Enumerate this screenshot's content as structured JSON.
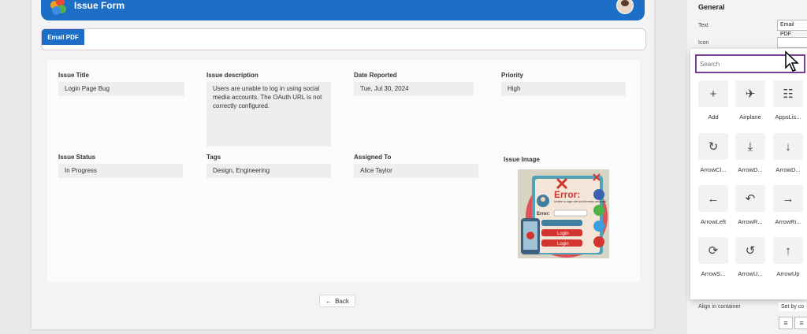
{
  "header": {
    "title": "Issue Form"
  },
  "toolbar": {
    "email_label": "Email PDF"
  },
  "form": {
    "issue_title": {
      "label": "Issue Title",
      "value": "Login Page Bug"
    },
    "issue_description": {
      "label": "Issue description",
      "value": "Users are unable to log in using social media accounts. The OAuth URL is not correctly configured."
    },
    "date_reported": {
      "label": "Date Reported",
      "value": "Tue, Jul 30, 2024"
    },
    "priority": {
      "label": "Priority",
      "value": "High"
    },
    "issue_status": {
      "label": "Issue Status",
      "value": "In Progress"
    },
    "tags": {
      "label": "Tags",
      "value": "Design, Engineering"
    },
    "assigned_to": {
      "label": "Assigned To",
      "value": "Alice Taylor"
    },
    "issue_image": {
      "label": "Issue Image",
      "error_word": "Error:",
      "error_text": "Unable to login with social media accounts",
      "error_label": "Error:",
      "login1": "Login",
      "login2": "Login"
    }
  },
  "back_label": "Back",
  "props": {
    "general": "General",
    "text_label": "Text",
    "text_value": "Email PDF",
    "icon_label": "Icon",
    "align_label": "Align in container",
    "set_label": "Set by co"
  },
  "icon_picker": {
    "search_placeholder": "Search",
    "icons": [
      {
        "label": "Add",
        "icon": "plus-icon",
        "glyph": "+"
      },
      {
        "label": "Airplane",
        "icon": "airplane-icon",
        "glyph": "✈"
      },
      {
        "label": "AppsLis...",
        "icon": "apps-list-icon",
        "glyph": "☷"
      },
      {
        "label": "ArrowCl...",
        "icon": "arrow-clockwise-icon",
        "glyph": "↻"
      },
      {
        "label": "ArrowD...",
        "icon": "arrow-download-icon",
        "glyph": "⤓"
      },
      {
        "label": "ArrowD...",
        "icon": "arrow-down-icon",
        "glyph": "↓"
      },
      {
        "label": "ArrowLeft",
        "icon": "arrow-left-icon",
        "glyph": "←"
      },
      {
        "label": "ArrowR...",
        "icon": "arrow-reset-icon",
        "glyph": "↶"
      },
      {
        "label": "ArrowRi...",
        "icon": "arrow-right-icon",
        "glyph": "→"
      },
      {
        "label": "ArrowS...",
        "icon": "arrow-sync-icon",
        "glyph": "⟳"
      },
      {
        "label": "ArrowU...",
        "icon": "arrow-undo-icon",
        "glyph": "↺"
      },
      {
        "label": "ArrowUp",
        "icon": "arrow-up-icon",
        "glyph": "↑"
      }
    ]
  },
  "colors": {
    "header": "#1c6ec7",
    "search_border": "#7b3e98",
    "tile": "#f2f2f4"
  }
}
